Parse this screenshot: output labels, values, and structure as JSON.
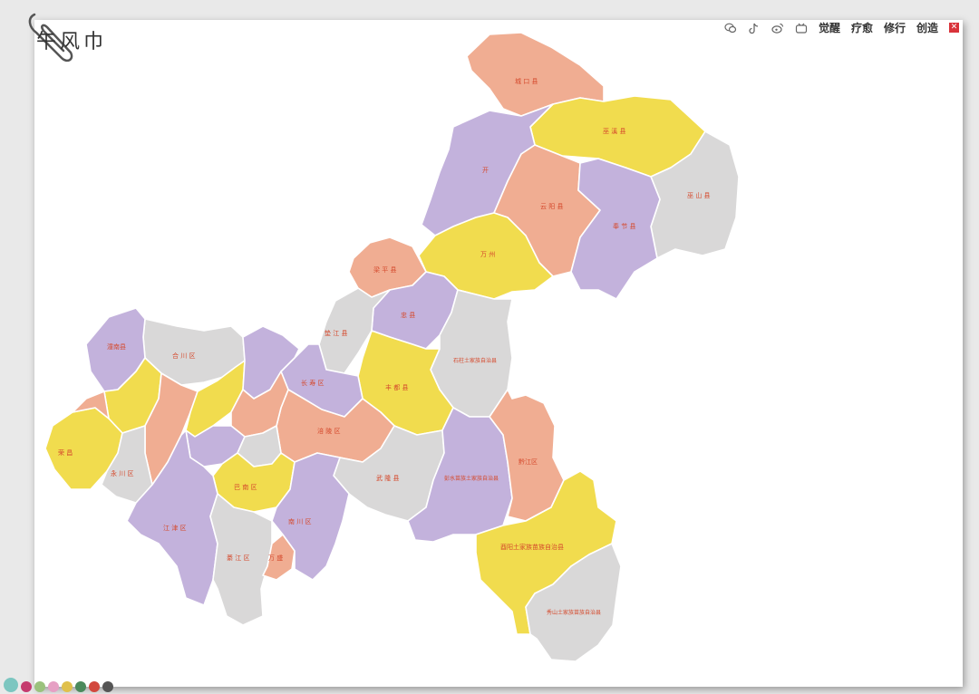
{
  "brand": {
    "logo_text": "午风巾"
  },
  "nav": {
    "icons": [
      "wechat-icon",
      "tiktok-icon",
      "weibo-icon",
      "bilibili-icon"
    ],
    "items": [
      "觉醒",
      "疗愈",
      "修行",
      "创造"
    ]
  },
  "colors": {
    "purple": "#c3b2dc",
    "orange": "#f0ad92",
    "yellow": "#f1dc4e",
    "gray": "#d9d8d8",
    "label": "#d5492c",
    "nav_red": "#d9333a"
  },
  "map": {
    "labels": {
      "chengkou": "城 口 县",
      "wuxi": "巫 溪 县",
      "kaizhou": "开",
      "yunyang": "云 阳 县",
      "fengjie": "奉 节 县",
      "wushan": "巫 山 县",
      "wanzhou": "万 州",
      "liangping": "梁 平 县",
      "zhongxian": "忠 县",
      "shizhu": "石柱土家族自治县",
      "fengdu": "丰 都 县",
      "pengshui": "彭水苗族土家族自治县",
      "qianjiang": "黔江区",
      "youyang": "酉阳土家族苗族自治县",
      "xiushan": "秀山土家族苗族自治县",
      "wulong": "武 隆 县",
      "fuling": "涪 陵 区",
      "changshou": "长 寿 区",
      "dianjiang": "垫 江 县",
      "hechuan": "合 川 区",
      "tongnan": "潼南县",
      "nanchuan": "南 川 区",
      "qijiang": "綦 江 区",
      "jiangjin": "江 津 区",
      "banan": "巴 南 区",
      "wansheng": "万 盛",
      "yongchuan": "永 川 区",
      "rongchang": "荣 昌"
    }
  }
}
